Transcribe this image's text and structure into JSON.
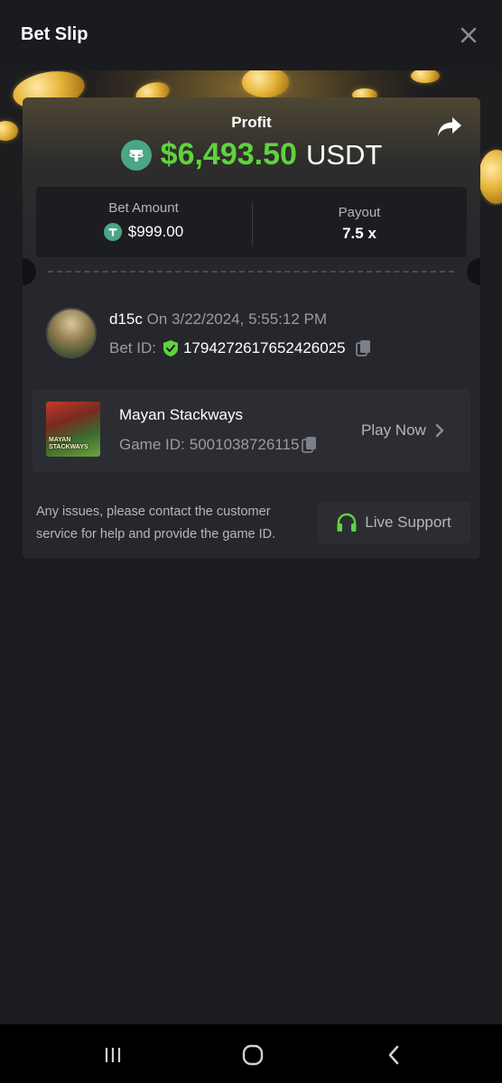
{
  "header": {
    "title": "Bet Slip",
    "close_icon": "close-icon"
  },
  "summary": {
    "profit_label": "Profit",
    "profit_amount": "$6,493.50",
    "currency": "USDT",
    "profit_color": "#5fd33d",
    "share_icon": "share-icon",
    "bet_amount_label": "Bet Amount",
    "bet_amount_value": "$999.00",
    "payout_label": "Payout",
    "payout_value": "7.5 x"
  },
  "user": {
    "username": "d15c",
    "bet_time": "On 3/22/2024, 5:55:12 PM",
    "bet_id_label": "Bet ID:",
    "bet_id": "1794272617652426025",
    "verified_icon": "verified-shield-icon",
    "copy_icon": "copy-icon"
  },
  "game": {
    "name": "Mayan Stackways",
    "thumb_text": "MAYAN STACKWAYS",
    "game_id_label": "Game ID:",
    "game_id": "5001038726115",
    "play_now_label": "Play Now"
  },
  "support": {
    "help_text": "Any issues, please contact the customer service for help and provide the game ID.",
    "live_support_label": "Live Support",
    "icon_color": "#5fd33d"
  },
  "navbar": {
    "icons": [
      "recent-apps-icon",
      "home-icon",
      "back-icon"
    ]
  }
}
